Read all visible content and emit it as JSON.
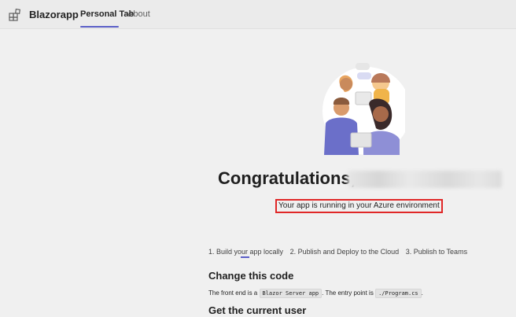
{
  "header": {
    "app_icon": "app-grid-icon",
    "app_name": "Blazorapp",
    "tabs": [
      {
        "label": "Personal Tab",
        "selected": true
      },
      {
        "label": "About",
        "selected": false
      }
    ]
  },
  "hero": {
    "heading_prefix": "Congratulations,",
    "status_text": "Your app is running in your Azure environment"
  },
  "steps": [
    "1. Build your app locally",
    "2. Publish and Deploy to the Cloud",
    "3. Publish to Teams"
  ],
  "section_change": {
    "title": "Change this code",
    "text_1": "The front end is a",
    "code_1": "Blazor Server app",
    "text_2": ". The entry point is",
    "code_2": "./Program.cs",
    "text_3": "."
  },
  "section_user": {
    "title": "Get the current user"
  },
  "colors": {
    "accent": "#5b5fc7",
    "highlight_border": "#e02727",
    "background": "#f0f0f0"
  }
}
